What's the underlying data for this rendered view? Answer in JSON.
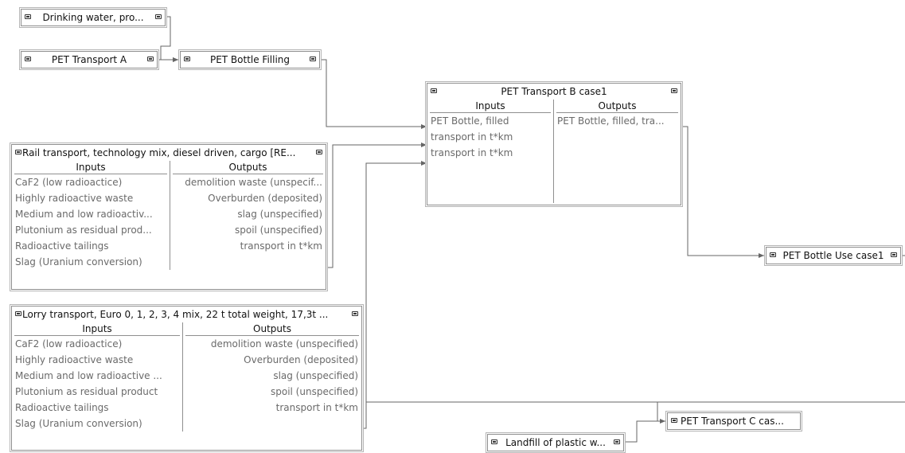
{
  "nodes": {
    "drinking_water": {
      "title": "Drinking water, pro..."
    },
    "pet_transport_a": {
      "title": "PET Transport A"
    },
    "pet_bottle_filling": {
      "title": "PET Bottle Filling"
    },
    "pet_transport_b": {
      "title": "PET Transport B case1",
      "inputs_header": "Inputs",
      "outputs_header": "Outputs",
      "inputs": [
        "PET Bottle, filled",
        "transport in t*km",
        "transport in t*km"
      ],
      "outputs": [
        "PET Bottle, filled, tra..."
      ]
    },
    "rail_transport": {
      "title": "Rail transport, technology mix, diesel driven, cargo [RE...",
      "inputs_header": "Inputs",
      "outputs_header": "Outputs",
      "inputs": [
        "CaF2 (low radioactice)",
        "Highly radioactive waste",
        "Medium and low radioactiv...",
        "Plutonium as residual prod...",
        "Radioactive tailings",
        "Slag (Uranium conversion)"
      ],
      "outputs": [
        "demolition waste (unspecif...",
        "Overburden (deposited)",
        "slag (unspecified)",
        "spoil (unspecified)",
        "transport in t*km"
      ]
    },
    "lorry_transport": {
      "title": "Lorry transport, Euro 0, 1, 2, 3, 4 mix, 22 t total weight, 17,3t ...",
      "inputs_header": "Inputs",
      "outputs_header": "Outputs",
      "inputs": [
        "CaF2 (low radioactice)",
        "Highly radioactive waste",
        " Medium and low radioactive ...",
        "Plutonium as residual product",
        "Radioactive tailings",
        "Slag (Uranium conversion)"
      ],
      "outputs": [
        "demolition waste (unspecified)",
        "Overburden (deposited)",
        "slag (unspecified)",
        "spoil (unspecified)",
        "transport in t*km"
      ]
    },
    "pet_bottle_use": {
      "title": "PET Bottle Use case1"
    },
    "pet_transport_c": {
      "title": "PET Transport C cas..."
    },
    "landfill": {
      "title": "Landfill of plastic w..."
    }
  }
}
